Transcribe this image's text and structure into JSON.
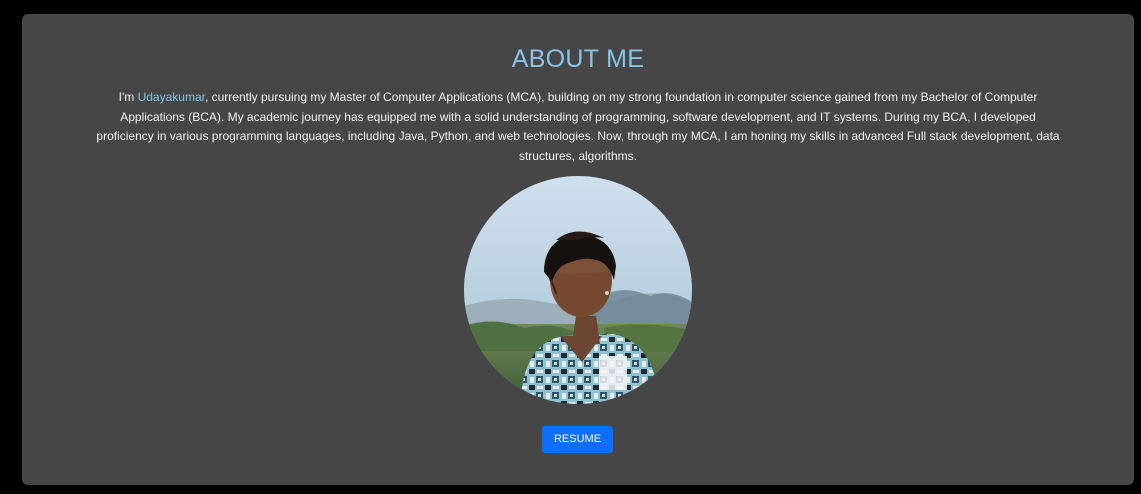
{
  "about": {
    "title": "ABOUT ME",
    "bio_prefix": "I'm ",
    "name": "Udayakumar",
    "bio_text": ", currently pursuing my Master of Computer Applications (MCA), building on my strong foundation in computer science gained from my Bachelor of Computer Applications (BCA). My academic journey has equipped me with a solid understanding of programming, software development, and IT systems. During my BCA, I developed proficiency in various programming languages, including Java, Python, and web technologies. Now, through my MCA, I am honing my skills in advanced Full stack development, data structures, algorithms.",
    "resume_label": "RESUME"
  },
  "colors": {
    "page_background": "#000000",
    "card_background": "#464646",
    "title_color": "#86c5e8",
    "name_color": "#7ec3e6",
    "body_text": "#f2f2f2",
    "button_background": "#0d6efd",
    "button_text": "#ffffff"
  },
  "icons": {
    "profile_photo": "profile-photo"
  }
}
